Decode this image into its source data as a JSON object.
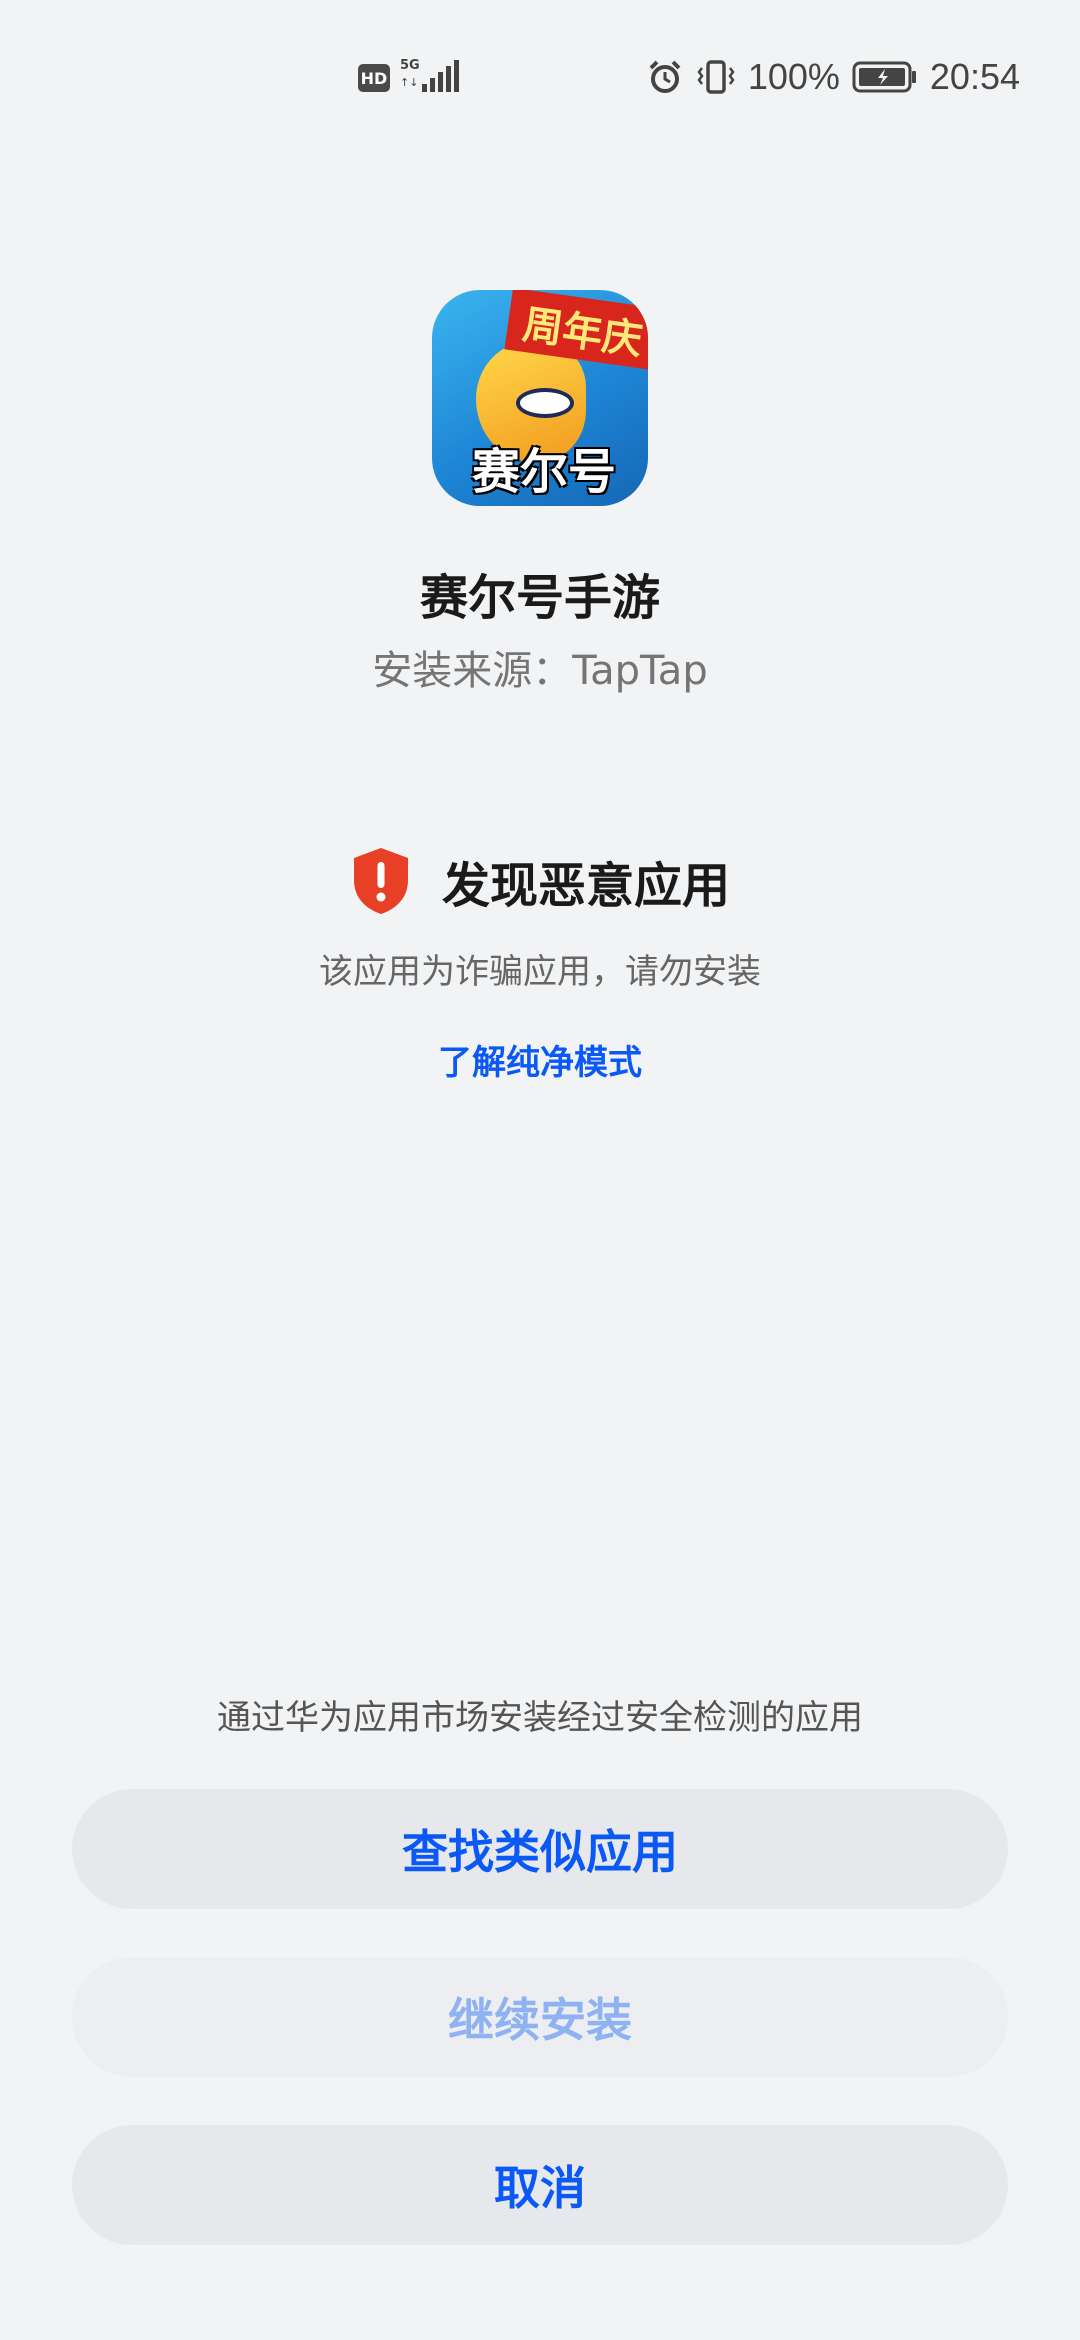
{
  "status_bar": {
    "hd_label": "HD",
    "network_label": "5G",
    "network_arrows": "↑↓",
    "battery_percent": "100%",
    "time": "20:54",
    "icons": [
      "hd-icon",
      "signal-icon",
      "alarm-icon",
      "vibrate-icon",
      "battery-icon"
    ]
  },
  "app": {
    "name": "赛尔号手游",
    "source": "安装来源：TapTap",
    "icon_banner_text": "周年庆",
    "icon_logo_text": "赛尔号"
  },
  "warning": {
    "icon": "shield-alert-icon",
    "title": "发现恶意应用",
    "description": "该应用为诈骗应用，请勿安装",
    "link_label": "了解纯净模式",
    "icon_color": "#e84026"
  },
  "footer": {
    "hint": "通过华为应用市场安装经过安全检测的应用",
    "find_similar_label": "查找类似应用",
    "continue_install_label": "继续安装",
    "cancel_label": "取消"
  },
  "colors": {
    "accent": "#0a59f7",
    "background": "#f1f3f5",
    "button_bg": "#e6e8eb",
    "disabled_text": "#8fb2f3",
    "danger": "#e84026"
  }
}
